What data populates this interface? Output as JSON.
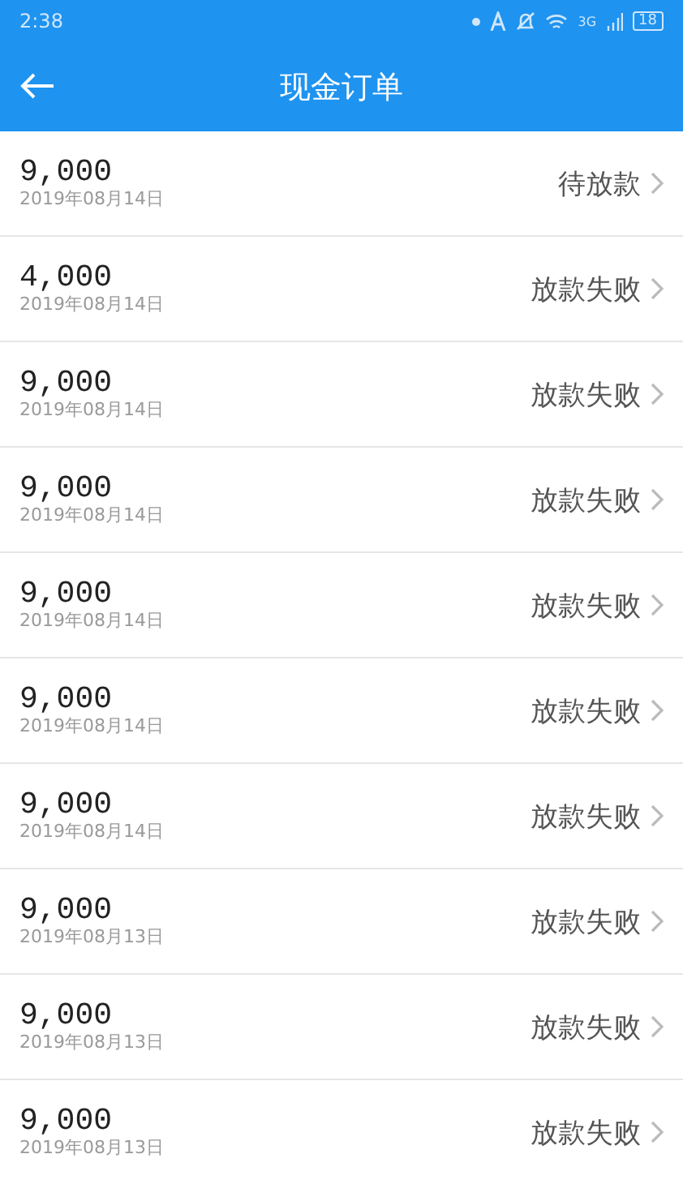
{
  "status_bar": {
    "time": "2:38",
    "network": "3G",
    "battery": "18"
  },
  "header": {
    "title": "现金订单"
  },
  "orders": [
    {
      "amount": "9,000",
      "date": "2019年08月14日",
      "status": "待放款"
    },
    {
      "amount": "4,000",
      "date": "2019年08月14日",
      "status": "放款失败"
    },
    {
      "amount": "9,000",
      "date": "2019年08月14日",
      "status": "放款失败"
    },
    {
      "amount": "9,000",
      "date": "2019年08月14日",
      "status": "放款失败"
    },
    {
      "amount": "9,000",
      "date": "2019年08月14日",
      "status": "放款失败"
    },
    {
      "amount": "9,000",
      "date": "2019年08月14日",
      "status": "放款失败"
    },
    {
      "amount": "9,000",
      "date": "2019年08月14日",
      "status": "放款失败"
    },
    {
      "amount": "9,000",
      "date": "2019年08月13日",
      "status": "放款失败"
    },
    {
      "amount": "9,000",
      "date": "2019年08月13日",
      "status": "放款失败"
    },
    {
      "amount": "9,000",
      "date": "2019年08月13日",
      "status": "放款失败"
    }
  ]
}
